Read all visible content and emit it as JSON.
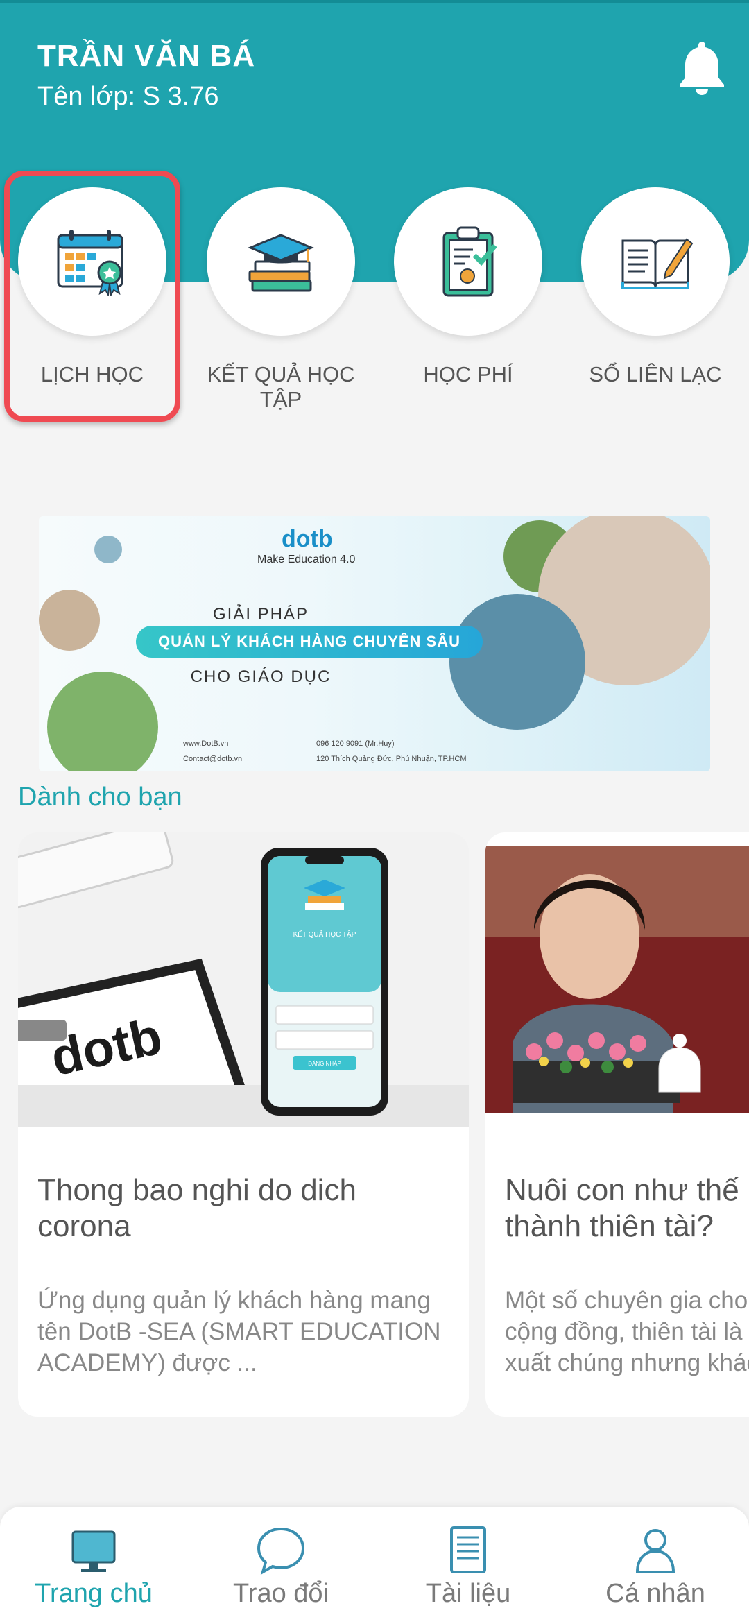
{
  "header": {
    "student_name": "TRẦN VĂN BÁ",
    "class_name": "Tên lớp: S 3.76",
    "notification_icon": "bell-icon",
    "background_color": "#1fa4ae"
  },
  "quick_menu": [
    {
      "label": "LỊCH HỌC",
      "icon": "calendar-icon",
      "highlighted": true
    },
    {
      "label": "KẾT QUẢ HỌC TẬP",
      "icon": "graduation-books-icon",
      "highlighted": false
    },
    {
      "label": "HỌC PHÍ",
      "icon": "clipboard-fee-icon",
      "highlighted": false
    },
    {
      "label": "SỔ LIÊN LẠC",
      "icon": "open-book-pen-icon",
      "highlighted": false
    }
  ],
  "banner": {
    "logo": "dotb",
    "tagline": "Make Education 4.0",
    "line1": "GIẢI PHÁP",
    "line2": "QUẢN LÝ KHÁCH HÀNG CHUYÊN SÂU",
    "line3": "CHO GIÁO DỤC",
    "website": "www.DotB.vn",
    "email": "Contact@dotb.vn",
    "phone": "096 120 9091 (Mr.Huy)",
    "address": "120 Thích Quảng Đức, Phú Nhuận, TP.HCM"
  },
  "section": {
    "title": "Dành cho bạn"
  },
  "cards": [
    {
      "title": "Thong bao nghi do dich corona",
      "description": "Ứng dụng quản lý khách hàng mang tên DotB -SEA (SMART EDUCATION ACADEMY) được ...",
      "phone_screen_title": "KẾT QUẢ HỌC TẬP",
      "phone_button": "ĐĂNG NHẬP",
      "brand_text": "dotb"
    },
    {
      "title": "Nuôi con như thế nào để trở thành thiên tài?",
      "description": "Một số chuyên gia cho rằng trong cộng đồng, thiên tài là những người xuất chúng nhưng khác biệt..."
    }
  ],
  "bottom_nav": [
    {
      "label": "Trang chủ",
      "icon": "monitor-icon",
      "active": true
    },
    {
      "label": "Trao đổi",
      "icon": "chat-bubble-icon",
      "active": false
    },
    {
      "label": "Tài liệu",
      "icon": "document-icon",
      "active": false
    },
    {
      "label": "Cá nhân",
      "icon": "user-icon",
      "active": false
    }
  ],
  "colors": {
    "primary": "#1fa4ae",
    "highlight": "#ef4a52",
    "inactive": "#7a7a7a"
  }
}
